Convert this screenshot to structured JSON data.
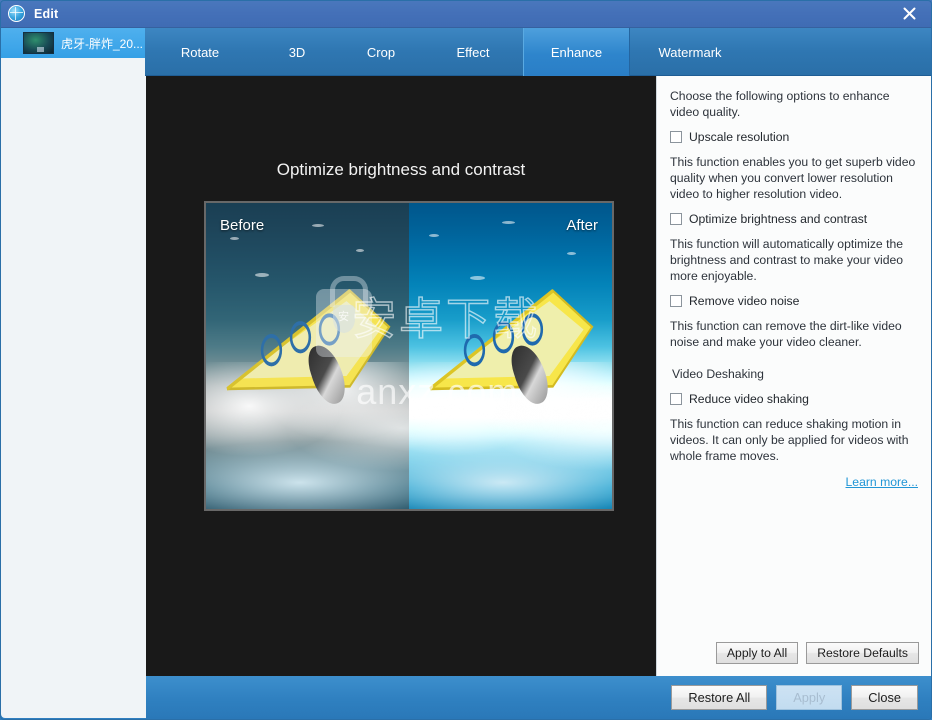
{
  "window": {
    "title": "Edit",
    "app_icon": "globe-icon",
    "close_icon": "close-icon"
  },
  "sidebar": {
    "clips": [
      {
        "label": "虎牙-胖炸_20...",
        "thumb": "video-thumbnail"
      }
    ]
  },
  "tabs": [
    {
      "id": "rotate",
      "label": "Rotate",
      "active": false
    },
    {
      "id": "3d",
      "label": "3D",
      "active": false
    },
    {
      "id": "crop",
      "label": "Crop",
      "active": false
    },
    {
      "id": "effect",
      "label": "Effect",
      "active": false
    },
    {
      "id": "enhance",
      "label": "Enhance",
      "active": true
    },
    {
      "id": "watermark",
      "label": "Watermark",
      "active": false
    }
  ],
  "preview": {
    "title": "Optimize brightness and contrast",
    "before_label": "Before",
    "after_label": "After",
    "watermark_cn": "安卓下载",
    "watermark_en": "anxz.com",
    "watermark_badge": "安"
  },
  "options": {
    "intro": "Choose the following options to enhance video quality.",
    "upscale": {
      "label": "Upscale resolution",
      "checked": false,
      "description": "This function enables you to get superb video quality when you convert lower resolution video to higher resolution video."
    },
    "brightness": {
      "label": "Optimize brightness and contrast",
      "checked": false,
      "description": "This function will automatically optimize the brightness and contrast to make your video more enjoyable."
    },
    "noise": {
      "label": "Remove video noise",
      "checked": false,
      "description": "This function can remove the dirt-like video noise and make your video cleaner."
    },
    "deshaking_group_title": "Video Deshaking",
    "shaking": {
      "label": "Reduce video shaking",
      "checked": false,
      "description": "This function can reduce shaking motion in videos. It can only be applied for videos with whole frame moves."
    },
    "learn_more": "Learn more...",
    "apply_to_all": "Apply to All",
    "restore_defaults": "Restore Defaults"
  },
  "footer": {
    "restore_all": "Restore All",
    "apply": "Apply",
    "apply_disabled": true,
    "close": "Close"
  },
  "colors": {
    "titlebar": "#4470b8",
    "tabbar": "#2f77b2",
    "tab_active": "#2e85cc",
    "sidebar": "#f0f4f7",
    "clip_selected": "#35a0e6",
    "stage": "#191919",
    "panel": "#fbfcfc",
    "link": "#2196d6",
    "bottombar": "#2f80c0"
  }
}
